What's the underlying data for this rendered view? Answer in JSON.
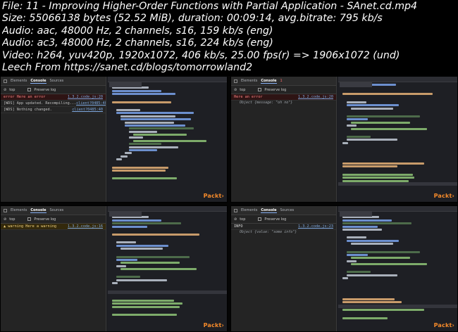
{
  "header": {
    "lines": [
      "File: 11 - Improving Higher-Order Functions with Partial Application - SAnet.cd.mp4",
      "Size: 55066138 bytes (52.52 MiB), duration: 00:09:14, avg.bitrate: 795 kb/s",
      "Audio: aac, 48000 Hz, 2 channels, s16, 159 kb/s (eng)",
      "Audio: ac3, 48000 Hz, 2 channels, s16, 224 kb/s (eng)",
      "Video: h264, yuv420p, 1920x1072, 406 kb/s, 25.00 fps(r) => 1906x1072 (und)",
      "Leech From https://sanet.cd/blogs/tomorrowland2"
    ]
  },
  "devtools": {
    "tab_elements": "Elements",
    "tab_console": "Console",
    "tab_sources": "Sources",
    "context": "top",
    "preserve_log": "Preserve log"
  },
  "panes": [
    {
      "lines": [
        {
          "kind": "err",
          "text": "error Here an error",
          "src": "1.3.2.code.js:20"
        },
        {
          "kind": "plain",
          "text": "[WDS] App updated. Recompiling...",
          "src": "client?0485:40"
        },
        {
          "kind": "plain",
          "text": "[WDS] Nothing changed.",
          "src": "client?0485:40"
        }
      ],
      "watermark": "Packt›"
    },
    {
      "error_badge": "1",
      "lines": [
        {
          "kind": "err",
          "text": "Here an error",
          "src": "1.3.2.code.js:20",
          "sub": "Object {message: \"oh no\"}"
        }
      ],
      "watermark": "Packt›"
    },
    {
      "lines": [
        {
          "kind": "warn",
          "text": "▲ warning Here a warning",
          "src": "1.3.2.code.js:16"
        }
      ],
      "watermark": "Packt›"
    },
    {
      "lines": [
        {
          "kind": "info",
          "text": "INFO",
          "src": "1.3.2.code.js:23",
          "sub": "Object {value: \"some info\"}"
        }
      ],
      "watermark": "Packt›"
    }
  ]
}
